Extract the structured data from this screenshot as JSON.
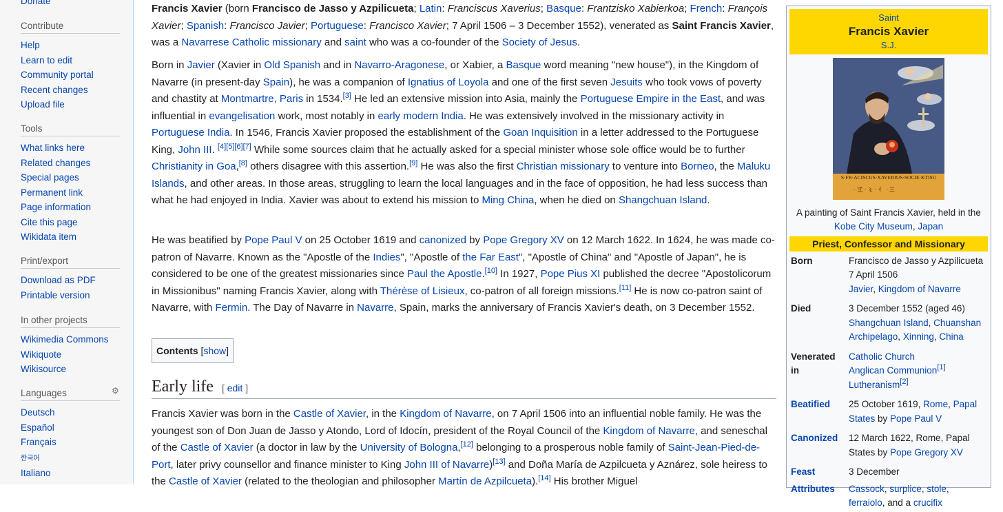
{
  "sidebar": {
    "top_link": "Donate",
    "contribute": {
      "heading": "Contribute",
      "items": [
        "Help",
        "Learn to edit",
        "Community portal",
        "Recent changes",
        "Upload file"
      ]
    },
    "tools": {
      "heading": "Tools",
      "items": [
        "What links here",
        "Related changes",
        "Special pages",
        "Permanent link",
        "Page information",
        "Cite this page",
        "Wikidata item"
      ]
    },
    "print": {
      "heading": "Print/export",
      "items": [
        "Download as PDF",
        "Printable version"
      ]
    },
    "projects": {
      "heading": "In other projects",
      "items": [
        "Wikimedia Commons",
        "Wikiquote",
        "Wikisource"
      ]
    },
    "languages": {
      "heading": "Languages",
      "items": [
        "Deutsch",
        "Español",
        "Français",
        "한국어",
        "Italiano"
      ]
    }
  },
  "article": {
    "toc": {
      "title": "Contents",
      "toggle": "show"
    },
    "section_early_life": {
      "title": "Early life",
      "edit": "edit"
    }
  },
  "infobox": {
    "pre_title": "Saint",
    "title": "Francis Xavier",
    "post_title": "S.J.",
    "image_inscription": "S·FR·ACISCUS·XAVERIUS·SOCIE·KTISU",
    "caption_text": "A painting of Saint Francis Xavier, held in the",
    "caption_link1": "Kobe City Museum",
    "caption_sep": ", ",
    "caption_link2": "Japan",
    "subheading": "Priest, Confessor and Missionary",
    "born_label": "Born",
    "born_name": "Francisco de Jasso y Azpilicueta",
    "born_date": "7 April 1506",
    "born_place1": "Javier",
    "born_place2": "Kingdom of Navarre",
    "died_label": "Died",
    "died_date": "3 December 1552 (aged 46)",
    "died_place1": "Shangchuan Island",
    "died_place2": "Chuanshan Archipelago",
    "died_place3": "Xinning",
    "died_place4": "China",
    "venerated_label": "Venerated in",
    "venerated1": "Catholic Church",
    "venerated2": "Anglican Communion",
    "venerated2_ref": "[1]",
    "venerated3": "Lutheranism",
    "venerated3_ref": "[2]",
    "beatified_label": "Beatified",
    "beatified_date": "25 October 1619, ",
    "beatified_place1": "Rome",
    "beatified_place2": "Papal States",
    "beatified_by": " by ",
    "beatified_pope": "Pope Paul V",
    "canonized_label": "Canonized",
    "canonized_text": "12 March 1622, Rome, Papal States by ",
    "canonized_pope": "Pope Gregory XV",
    "feast_label": "Feast",
    "feast_date": "3 December",
    "attributes_label": "Attributes",
    "attr1": "Cassock",
    "attr2": "surplice",
    "attr3": "stole",
    "attr4": "ferraiolo",
    "attr_and": ", and a ",
    "attr5": "crucifix"
  },
  "colors": {
    "link": "#0645ad",
    "infobox_header": "#ffd700",
    "sidebar_bg": "#f6f6f6"
  }
}
